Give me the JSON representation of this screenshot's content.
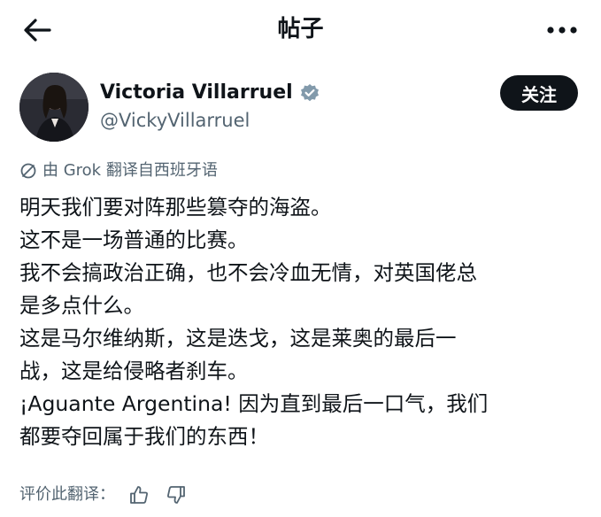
{
  "header": {
    "title": "帖子",
    "back_icon": "arrow-left-icon",
    "more_icon": "more-horizontal-icon"
  },
  "author": {
    "name": "Victoria Villarruel",
    "handle": "@VickyVillarruel",
    "verified_icon": "verified-badge-icon",
    "verified_color": "#829aab",
    "follow_label": "关注"
  },
  "translation": {
    "note": "由 Grok 翻译自西班牙语",
    "icon": "translate-icon"
  },
  "post": {
    "lines": [
      "明天我们要对阵那些篡夺的海盗。",
      "这不是一场普通的比赛。",
      "我不会搞政治正确，也不会冷血无情，对英国佬总",
      "是多点什么。",
      "这是马尔维纳斯，这是迭戈，这是莱奥的最后一",
      "战，这是给侵略者刹车。",
      "¡Aguante Argentina! 因为直到最后一口气，我们",
      "都要夺回属于我们的东西！"
    ]
  },
  "rating": {
    "label": "评价此翻译：",
    "thumbs_up_icon": "thumbs-up-icon",
    "thumbs_down_icon": "thumbs-down-icon"
  },
  "colors": {
    "text": "#0f1419",
    "secondary": "#536471",
    "follow_bg": "#0f1419"
  }
}
